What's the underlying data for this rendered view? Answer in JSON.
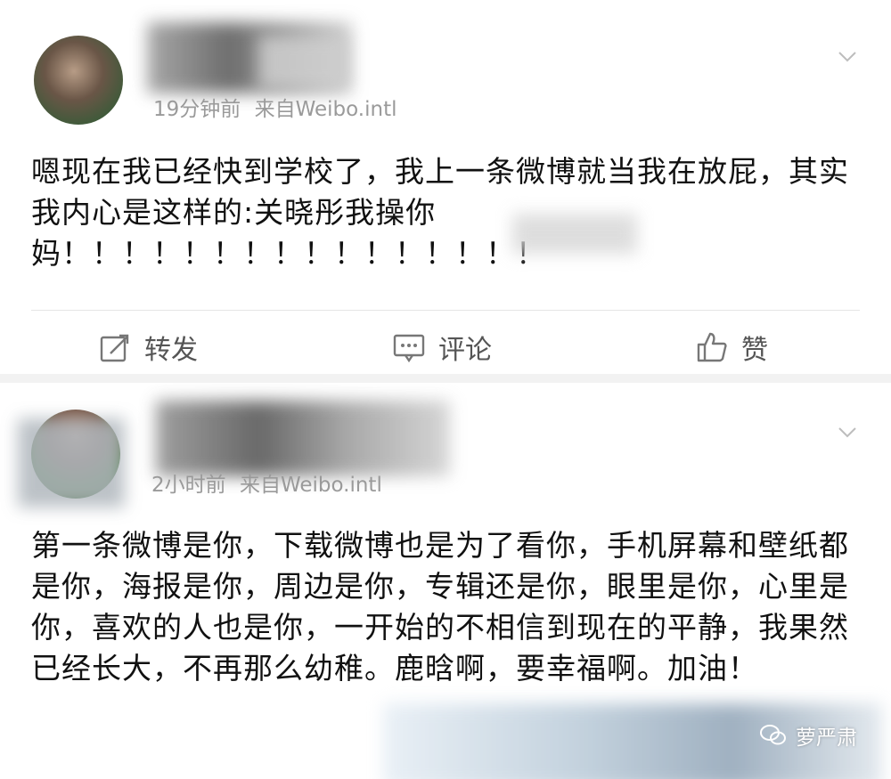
{
  "posts": [
    {
      "username": "",
      "time": "19分钟前",
      "source": "来自Weibo.intl",
      "text": "嗯现在我已经快到学校了，我上一条微博就当我在放屁，其实我内心是这样的:关晓彤我操你妈！！！！！！！！！！！！！！！！",
      "actions": {
        "repost": "转发",
        "comment": "评论",
        "like": "赞"
      }
    },
    {
      "username": "",
      "time": "2小时前",
      "source": "来自Weibo.intl",
      "text": "第一条微博是你，下载微博也是为了看你，手机屏幕和壁纸都是你，海报是你，周边是你，专辑还是你，眼里是你，心里是你，喜欢的人也是你，一开始的不相信到现在的平静，我果然已经长大，不再那么幼稚。鹿晗啊，要幸福啊。加油！"
    }
  ],
  "icons": [
    "chevron-down-icon",
    "repost-icon",
    "comment-icon",
    "like-icon",
    "wechat-icon"
  ],
  "watermark": "萝严肃",
  "colors": {
    "background": "#f2f2f2",
    "card": "#ffffff",
    "text": "#111111",
    "meta": "#9a9a9a",
    "action": "#555555"
  }
}
